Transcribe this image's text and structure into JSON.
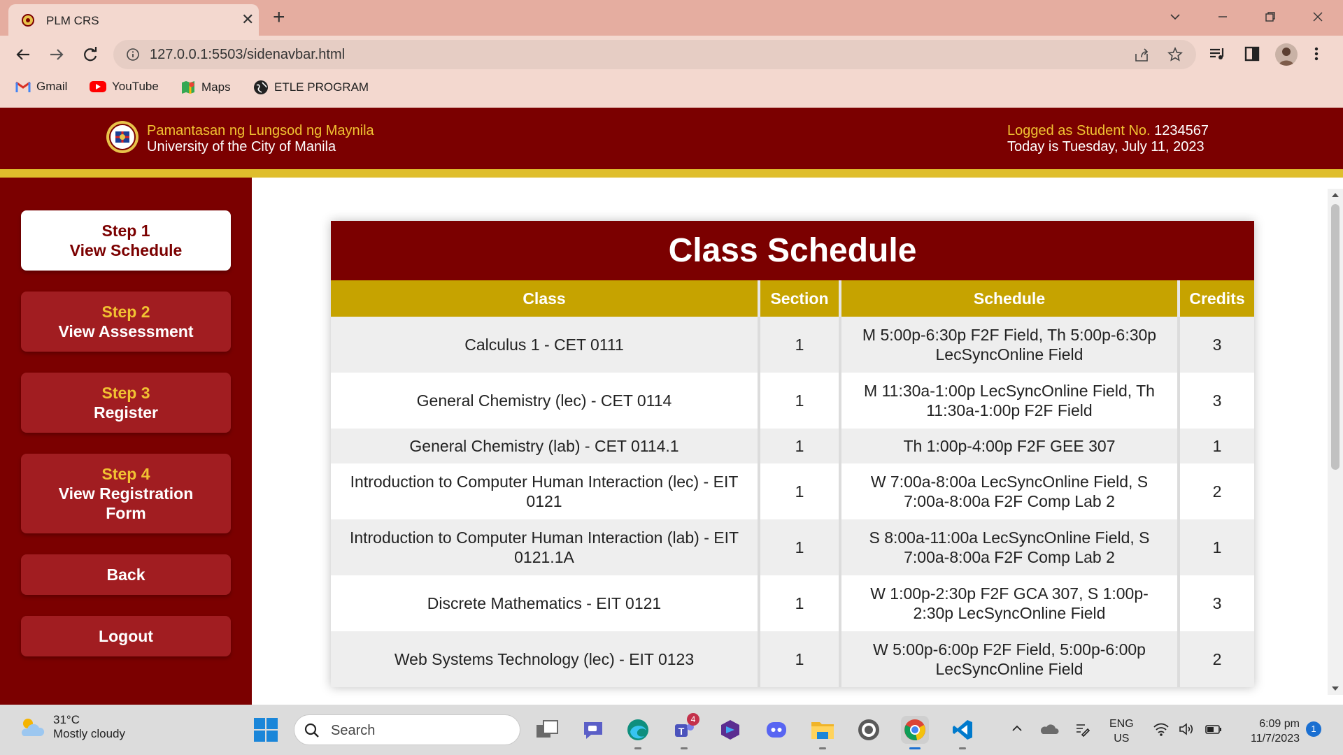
{
  "browser": {
    "tab_title": "PLM CRS",
    "url": "127.0.0.1:5503/sidenavbar.html",
    "bookmarks": [
      {
        "label": "Gmail",
        "icon": "gmail-icon"
      },
      {
        "label": "YouTube",
        "icon": "youtube-icon"
      },
      {
        "label": "Maps",
        "icon": "maps-icon"
      },
      {
        "label": "ETLE PROGRAM",
        "icon": "globe-icon"
      }
    ]
  },
  "header": {
    "univ_name_filipino": "Pamantasan ng Lungsod ng Maynila",
    "univ_name_english": "University of the City of Manila",
    "logged_label": "Logged as Student No.",
    "student_no": "1234567",
    "today_label": "Today is",
    "today_date": "Tuesday, July 11, 2023"
  },
  "sidebar": {
    "steps": [
      {
        "step": "Step 1",
        "label": "View Schedule",
        "active": true
      },
      {
        "step": "Step 2",
        "label": "View Assessment",
        "active": false
      },
      {
        "step": "Step 3",
        "label": "Register",
        "active": false
      },
      {
        "step": "Step 4",
        "label": "View Registration Form",
        "active": false
      }
    ],
    "back_label": "Back",
    "logout_label": "Logout"
  },
  "schedule": {
    "title": "Class Schedule",
    "columns": [
      "Class",
      "Section",
      "Schedule",
      "Credits"
    ],
    "rows": [
      {
        "class": "Calculus 1 - CET 0111",
        "section": "1",
        "schedule": "M 5:00p-6:30p F2F Field, Th 5:00p-6:30p LecSyncOnline Field",
        "credits": "3"
      },
      {
        "class": "General Chemistry (lec) - CET 0114",
        "section": "1",
        "schedule": "M 11:30a-1:00p LecSyncOnline Field, Th 11:30a-1:00p F2F Field",
        "credits": "3"
      },
      {
        "class": "General Chemistry (lab) - CET 0114.1",
        "section": "1",
        "schedule": "Th 1:00p-4:00p F2F GEE 307",
        "credits": "1"
      },
      {
        "class": "Introduction to Computer Human Interaction (lec) - EIT 0121",
        "section": "1",
        "schedule": "W 7:00a-8:00a LecSyncOnline Field, S 7:00a-8:00a F2F Comp Lab 2",
        "credits": "2"
      },
      {
        "class": "Introduction to Computer Human Interaction (lab) - EIT 0121.1A",
        "section": "1",
        "schedule": "S 8:00a-11:00a LecSyncOnline Field, S 7:00a-8:00a F2F Comp Lab 2",
        "credits": "1"
      },
      {
        "class": "Discrete Mathematics - EIT 0121",
        "section": "1",
        "schedule": "W 1:00p-2:30p F2F GCA 307, S 1:00p-2:30p LecSyncOnline Field",
        "credits": "3"
      },
      {
        "class": "Web Systems Technology (lec) - EIT 0123",
        "section": "1",
        "schedule": "W 5:00p-6:00p F2F Field, 5:00p-6:00p LecSyncOnline Field",
        "credits": "2"
      }
    ]
  },
  "taskbar": {
    "weather_temp": "31°C",
    "weather_cond": "Mostly cloudy",
    "search_placeholder": "Search",
    "teams_badge": "4",
    "lang_line1": "ENG",
    "lang_line2": "US",
    "time": "6:09 pm",
    "date": "11/7/2023",
    "notification_count": "1"
  },
  "colors": {
    "maroon": "#7b0000",
    "gold": "#c6a300",
    "gold_text": "#f1c232",
    "step_button": "#a11d21"
  }
}
